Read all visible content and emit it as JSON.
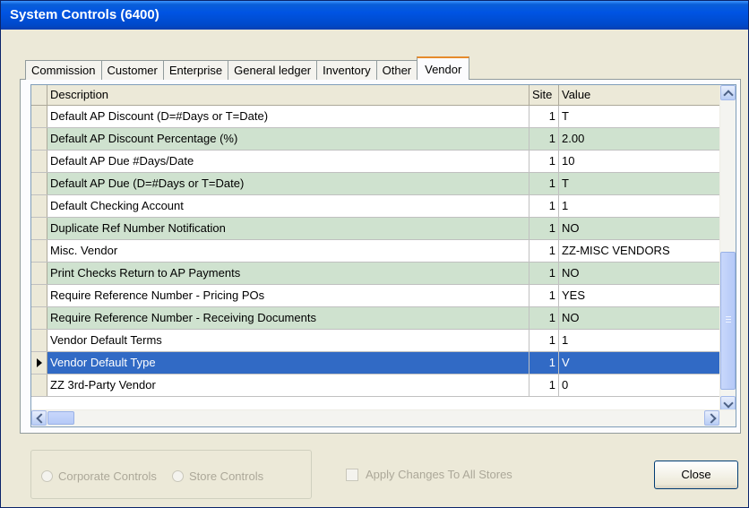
{
  "window": {
    "title": "System Controls (6400)"
  },
  "tabs": [
    {
      "label": "Commission"
    },
    {
      "label": "Customer"
    },
    {
      "label": "Enterprise"
    },
    {
      "label": "General ledger"
    },
    {
      "label": "Inventory"
    },
    {
      "label": "Other"
    },
    {
      "label": "Vendor"
    }
  ],
  "active_tab": "Vendor",
  "grid": {
    "columns": [
      "Description",
      "Site",
      "Value"
    ],
    "rows": [
      {
        "description": "Default AP Discount (D=#Days or T=Date)",
        "site": "1",
        "value": "T"
      },
      {
        "description": "Default AP Discount Percentage (%)",
        "site": "1",
        "value": "2.00"
      },
      {
        "description": "Default AP Due #Days/Date",
        "site": "1",
        "value": "10"
      },
      {
        "description": "Default AP Due (D=#Days or T=Date)",
        "site": "1",
        "value": "T"
      },
      {
        "description": "Default Checking Account",
        "site": "1",
        "value": "1"
      },
      {
        "description": "Duplicate Ref Number Notification",
        "site": "1",
        "value": "NO"
      },
      {
        "description": "Misc. Vendor",
        "site": "1",
        "value": "ZZ-MISC VENDORS"
      },
      {
        "description": "Print Checks Return to AP Payments",
        "site": "1",
        "value": "NO"
      },
      {
        "description": "Require Reference Number - Pricing POs",
        "site": "1",
        "value": "YES"
      },
      {
        "description": "Require Reference Number - Receiving Documents",
        "site": "1",
        "value": "NO"
      },
      {
        "description": "Vendor Default Terms",
        "site": "1",
        "value": "1"
      },
      {
        "description": "Vendor Default Type",
        "site": "1",
        "value": "V"
      },
      {
        "description": "ZZ 3rd-Party Vendor",
        "site": "1",
        "value": "0"
      }
    ],
    "selected_row": "Vendor Default Type"
  },
  "controls": {
    "corporate_label": "Corporate Controls",
    "store_label": "Store Controls",
    "apply_label": "Apply Changes To All Stores",
    "close_label": "Close"
  },
  "colors": {
    "title_blue": "#0054e3",
    "alt_row": "#cfe2cf",
    "selected_row": "#316ac5"
  }
}
